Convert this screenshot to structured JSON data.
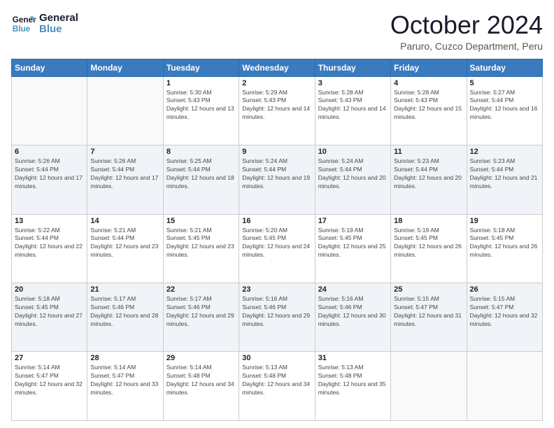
{
  "header": {
    "logo_line1": "General",
    "logo_line2": "Blue",
    "month": "October 2024",
    "location": "Paruro, Cuzco Department, Peru"
  },
  "days_of_week": [
    "Sunday",
    "Monday",
    "Tuesday",
    "Wednesday",
    "Thursday",
    "Friday",
    "Saturday"
  ],
  "weeks": [
    [
      {
        "day": "",
        "sunrise": "",
        "sunset": "",
        "daylight": ""
      },
      {
        "day": "",
        "sunrise": "",
        "sunset": "",
        "daylight": ""
      },
      {
        "day": "1",
        "sunrise": "Sunrise: 5:30 AM",
        "sunset": "Sunset: 5:43 PM",
        "daylight": "Daylight: 12 hours and 13 minutes."
      },
      {
        "day": "2",
        "sunrise": "Sunrise: 5:29 AM",
        "sunset": "Sunset: 5:43 PM",
        "daylight": "Daylight: 12 hours and 14 minutes."
      },
      {
        "day": "3",
        "sunrise": "Sunrise: 5:28 AM",
        "sunset": "Sunset: 5:43 PM",
        "daylight": "Daylight: 12 hours and 14 minutes."
      },
      {
        "day": "4",
        "sunrise": "Sunrise: 5:28 AM",
        "sunset": "Sunset: 5:43 PM",
        "daylight": "Daylight: 12 hours and 15 minutes."
      },
      {
        "day": "5",
        "sunrise": "Sunrise: 5:27 AM",
        "sunset": "Sunset: 5:44 PM",
        "daylight": "Daylight: 12 hours and 16 minutes."
      }
    ],
    [
      {
        "day": "6",
        "sunrise": "Sunrise: 5:26 AM",
        "sunset": "Sunset: 5:44 PM",
        "daylight": "Daylight: 12 hours and 17 minutes."
      },
      {
        "day": "7",
        "sunrise": "Sunrise: 5:26 AM",
        "sunset": "Sunset: 5:44 PM",
        "daylight": "Daylight: 12 hours and 17 minutes."
      },
      {
        "day": "8",
        "sunrise": "Sunrise: 5:25 AM",
        "sunset": "Sunset: 5:44 PM",
        "daylight": "Daylight: 12 hours and 18 minutes."
      },
      {
        "day": "9",
        "sunrise": "Sunrise: 5:24 AM",
        "sunset": "Sunset: 5:44 PM",
        "daylight": "Daylight: 12 hours and 19 minutes."
      },
      {
        "day": "10",
        "sunrise": "Sunrise: 5:24 AM",
        "sunset": "Sunset: 5:44 PM",
        "daylight": "Daylight: 12 hours and 20 minutes."
      },
      {
        "day": "11",
        "sunrise": "Sunrise: 5:23 AM",
        "sunset": "Sunset: 5:44 PM",
        "daylight": "Daylight: 12 hours and 20 minutes."
      },
      {
        "day": "12",
        "sunrise": "Sunrise: 5:23 AM",
        "sunset": "Sunset: 5:44 PM",
        "daylight": "Daylight: 12 hours and 21 minutes."
      }
    ],
    [
      {
        "day": "13",
        "sunrise": "Sunrise: 5:22 AM",
        "sunset": "Sunset: 5:44 PM",
        "daylight": "Daylight: 12 hours and 22 minutes."
      },
      {
        "day": "14",
        "sunrise": "Sunrise: 5:21 AM",
        "sunset": "Sunset: 5:44 PM",
        "daylight": "Daylight: 12 hours and 23 minutes."
      },
      {
        "day": "15",
        "sunrise": "Sunrise: 5:21 AM",
        "sunset": "Sunset: 5:45 PM",
        "daylight": "Daylight: 12 hours and 23 minutes."
      },
      {
        "day": "16",
        "sunrise": "Sunrise: 5:20 AM",
        "sunset": "Sunset: 5:45 PM",
        "daylight": "Daylight: 12 hours and 24 minutes."
      },
      {
        "day": "17",
        "sunrise": "Sunrise: 5:19 AM",
        "sunset": "Sunset: 5:45 PM",
        "daylight": "Daylight: 12 hours and 25 minutes."
      },
      {
        "day": "18",
        "sunrise": "Sunrise: 5:19 AM",
        "sunset": "Sunset: 5:45 PM",
        "daylight": "Daylight: 12 hours and 26 minutes."
      },
      {
        "day": "19",
        "sunrise": "Sunrise: 5:18 AM",
        "sunset": "Sunset: 5:45 PM",
        "daylight": "Daylight: 12 hours and 26 minutes."
      }
    ],
    [
      {
        "day": "20",
        "sunrise": "Sunrise: 5:18 AM",
        "sunset": "Sunset: 5:45 PM",
        "daylight": "Daylight: 12 hours and 27 minutes."
      },
      {
        "day": "21",
        "sunrise": "Sunrise: 5:17 AM",
        "sunset": "Sunset: 5:46 PM",
        "daylight": "Daylight: 12 hours and 28 minutes."
      },
      {
        "day": "22",
        "sunrise": "Sunrise: 5:17 AM",
        "sunset": "Sunset: 5:46 PM",
        "daylight": "Daylight: 12 hours and 29 minutes."
      },
      {
        "day": "23",
        "sunrise": "Sunrise: 5:16 AM",
        "sunset": "Sunset: 5:46 PM",
        "daylight": "Daylight: 12 hours and 29 minutes."
      },
      {
        "day": "24",
        "sunrise": "Sunrise: 5:16 AM",
        "sunset": "Sunset: 5:46 PM",
        "daylight": "Daylight: 12 hours and 30 minutes."
      },
      {
        "day": "25",
        "sunrise": "Sunrise: 5:15 AM",
        "sunset": "Sunset: 5:47 PM",
        "daylight": "Daylight: 12 hours and 31 minutes."
      },
      {
        "day": "26",
        "sunrise": "Sunrise: 5:15 AM",
        "sunset": "Sunset: 5:47 PM",
        "daylight": "Daylight: 12 hours and 32 minutes."
      }
    ],
    [
      {
        "day": "27",
        "sunrise": "Sunrise: 5:14 AM",
        "sunset": "Sunset: 5:47 PM",
        "daylight": "Daylight: 12 hours and 32 minutes."
      },
      {
        "day": "28",
        "sunrise": "Sunrise: 5:14 AM",
        "sunset": "Sunset: 5:47 PM",
        "daylight": "Daylight: 12 hours and 33 minutes."
      },
      {
        "day": "29",
        "sunrise": "Sunrise: 5:14 AM",
        "sunset": "Sunset: 5:48 PM",
        "daylight": "Daylight: 12 hours and 34 minutes."
      },
      {
        "day": "30",
        "sunrise": "Sunrise: 5:13 AM",
        "sunset": "Sunset: 5:48 PM",
        "daylight": "Daylight: 12 hours and 34 minutes."
      },
      {
        "day": "31",
        "sunrise": "Sunrise: 5:13 AM",
        "sunset": "Sunset: 5:48 PM",
        "daylight": "Daylight: 12 hours and 35 minutes."
      },
      {
        "day": "",
        "sunrise": "",
        "sunset": "",
        "daylight": ""
      },
      {
        "day": "",
        "sunrise": "",
        "sunset": "",
        "daylight": ""
      }
    ]
  ]
}
